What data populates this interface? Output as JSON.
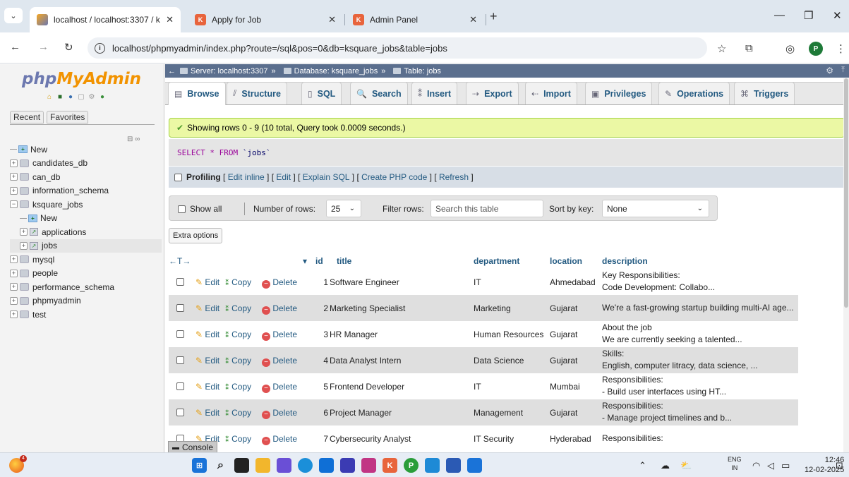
{
  "browser": {
    "tabs": [
      {
        "title": "localhost / localhost:3307 / ksq",
        "favicon": "phpmyadmin-icon",
        "active": true
      },
      {
        "title": "Apply for Job",
        "favicon": "ksquare-icon",
        "active": false
      },
      {
        "title": "Admin Panel",
        "favicon": "ksquare-icon",
        "active": false
      }
    ],
    "favicon_letter": "K",
    "url": "localhost/phpmyadmin/index.php?route=/sql&pos=0&db=ksquare_jobs&table=jobs",
    "profile_initial": "P"
  },
  "pma": {
    "logo_php": "php",
    "logo_myadmin": "MyAdmin",
    "nav_tabs": [
      "Recent",
      "Favorites"
    ],
    "tree": [
      {
        "label": "New",
        "kind": "new",
        "level": 0
      },
      {
        "label": "candidates_db",
        "kind": "db",
        "level": 0
      },
      {
        "label": "can_db",
        "kind": "db",
        "level": 0
      },
      {
        "label": "information_schema",
        "kind": "db",
        "level": 0
      },
      {
        "label": "ksquare_jobs",
        "kind": "db",
        "level": 0,
        "expanded": true
      },
      {
        "label": "New",
        "kind": "new",
        "level": 1
      },
      {
        "label": "applications",
        "kind": "table",
        "level": 1
      },
      {
        "label": "jobs",
        "kind": "table",
        "level": 1,
        "selected": true
      },
      {
        "label": "mysql",
        "kind": "db",
        "level": 0
      },
      {
        "label": "people",
        "kind": "db",
        "level": 0
      },
      {
        "label": "performance_schema",
        "kind": "db",
        "level": 0
      },
      {
        "label": "phpmyadmin",
        "kind": "db",
        "level": 0
      },
      {
        "label": "test",
        "kind": "db",
        "level": 0
      }
    ],
    "breadcrumb": {
      "server": "Server: localhost:3307",
      "database": "Database: ksquare_jobs",
      "table": "Table: jobs",
      "separator": "»"
    },
    "menu": [
      "Browse",
      "Structure",
      "SQL",
      "Search",
      "Insert",
      "Export",
      "Import",
      "Privileges",
      "Operations",
      "Triggers"
    ],
    "success_message": "Showing rows 0 - 9 (10 total, Query took 0.0009 seconds.)",
    "sql": {
      "select": "SELECT",
      "star": "*",
      "from": "FROM",
      "table": "`jobs`"
    },
    "profiling": {
      "label": "Profiling",
      "links": [
        "Edit inline",
        "Edit",
        "Explain SQL",
        "Create PHP code",
        "Refresh"
      ]
    },
    "controls": {
      "show_all": "Show all",
      "rows_label": "Number of rows:",
      "rows_value": "25",
      "filter_label": "Filter rows:",
      "filter_placeholder": "Search this table",
      "sort_label": "Sort by key:",
      "sort_value": "None"
    },
    "extra_options": "Extra options",
    "columns": {
      "arrows": "←T→",
      "id": "id",
      "title": "title",
      "department": "department",
      "location": "location",
      "description": "description"
    },
    "row_actions": {
      "edit": "Edit",
      "copy": "Copy",
      "delete": "Delete"
    },
    "rows": [
      {
        "id": "1",
        "title": "Software Engineer",
        "department": "IT",
        "location": "Ahmedabad",
        "desc1": "Key Responsibilities:",
        "desc2": "Code Development: Collabo..."
      },
      {
        "id": "2",
        "title": "Marketing Specialist",
        "department": "Marketing",
        "location": "Gujarat",
        "desc1": "We're a fast-growing startup building multi-AI age...",
        "desc2": ""
      },
      {
        "id": "3",
        "title": "HR Manager",
        "department": "Human Resources",
        "location": "Gujarat",
        "desc1": "About the job",
        "desc2": "We are currently seeking a talented..."
      },
      {
        "id": "4",
        "title": "Data Analyst Intern",
        "department": "Data Science",
        "location": "Gujarat",
        "desc1": "Skills:",
        "desc2": "English, computer litracy, data science, ..."
      },
      {
        "id": "5",
        "title": "Frontend Developer",
        "department": "IT",
        "location": "Mumbai",
        "desc1": "Responsibilities:",
        "desc2": "- Build user interfaces using HT..."
      },
      {
        "id": "6",
        "title": "Project Manager",
        "department": "Management",
        "location": "Gujarat",
        "desc1": "Responsibilities:",
        "desc2": "- Manage project timelines and b..."
      },
      {
        "id": "7",
        "title": "Cybersecurity Analyst",
        "department": "IT Security",
        "location": "Hyderabad",
        "desc1": "Responsibilities:",
        "desc2": ""
      }
    ],
    "console": "Console"
  },
  "taskbar": {
    "notification_count": "4",
    "lang_line1": "ENG",
    "lang_line2": "IN",
    "time": "12:46",
    "date": "12-02-2025"
  },
  "colors": {
    "accent": "#235a81",
    "success_bg": "#ebf8a4",
    "breadcrumb_bg": "#5b6f8e"
  }
}
